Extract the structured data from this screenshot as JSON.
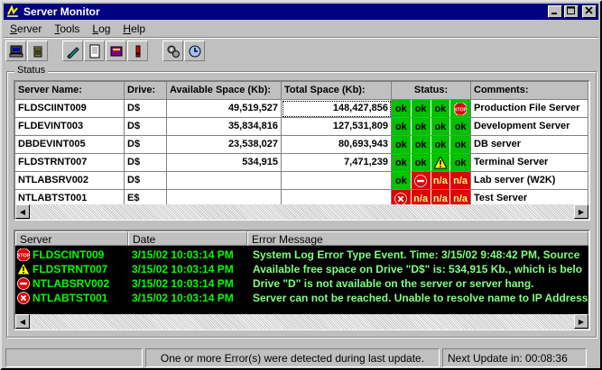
{
  "window": {
    "title": "Server Monitor",
    "controls": {
      "minimize": "_",
      "maximize": "□",
      "close": "×"
    }
  },
  "menu": [
    {
      "label": "Server",
      "u": "S"
    },
    {
      "label": "Tools",
      "u": "T"
    },
    {
      "label": "Log",
      "u": "L"
    },
    {
      "label": "Help",
      "u": "H"
    }
  ],
  "toolbar": [
    "computer-icon",
    "trash-icon",
    "pencil-icon",
    "notepad-icon",
    "book-icon",
    "exclamation-icon",
    "gears-icon",
    "clock-icon"
  ],
  "status_group": {
    "label": "Status"
  },
  "grid": {
    "headers": [
      "Server Name:",
      "Drive:",
      "Available Space (Kb):",
      "Total Space (Kb):",
      "Status:",
      "Comments:"
    ],
    "rows": [
      {
        "server": "FLDSCIINT009",
        "drive": "D$",
        "available": "49,519,527",
        "total": "148,427,856",
        "status": [
          "ok",
          "ok",
          "ok",
          "stop"
        ],
        "comment": "Production File Server"
      },
      {
        "server": "FLDEVINT003",
        "drive": "D$",
        "available": "35,834,816",
        "total": "127,531,809",
        "status": [
          "ok",
          "ok",
          "ok",
          "ok"
        ],
        "comment": "Development Server"
      },
      {
        "server": "DBDEVINT005",
        "drive": "D$",
        "available": "23,538,027",
        "total": "80,693,943",
        "status": [
          "ok",
          "ok",
          "ok",
          "ok"
        ],
        "comment": "DB server"
      },
      {
        "server": "FLDSTRNT007",
        "drive": "D$",
        "available": "534,915",
        "total": "7,471,239",
        "status": [
          "ok",
          "ok",
          "warn",
          "ok"
        ],
        "comment": "Terminal Server"
      },
      {
        "server": "NTLABSRV002",
        "drive": "D$",
        "available": "",
        "total": "",
        "status": [
          "ok",
          "noentry",
          "na",
          "na"
        ],
        "comment": "Lab server (W2K)"
      },
      {
        "server": "NTLABTST001",
        "drive": "E$",
        "available": "",
        "total": "",
        "status": [
          "error",
          "na",
          "na",
          "na"
        ],
        "comment": "Test Server"
      }
    ],
    "status_text": {
      "ok": "ok",
      "na": "n/a"
    }
  },
  "log": {
    "headers": [
      "Server",
      "Date",
      "Error Message"
    ],
    "rows": [
      {
        "icon": "stop",
        "server": "FLDSCINT009",
        "date": "3/15/02 10:03:14 PM",
        "message": "System Log Error Type Event. Time: 3/15/02 9:48:42 PM, Source"
      },
      {
        "icon": "warn",
        "server": "FLDSTRNT007",
        "date": "3/15/02 10:03:14 PM",
        "message": "Available free space on Drive \"D$\" is: 534,915 Kb., which is belo"
      },
      {
        "icon": "noentry",
        "server": "NTLABSRV002",
        "date": "3/15/02 10:03:14 PM",
        "message": "Drive \"D\" is not available on the server or server hang."
      },
      {
        "icon": "error",
        "server": "NTLABTST001",
        "date": "3/15/02 10:03:14 PM",
        "message": "Server can not be reached. Unable to resolve name to IP Address"
      }
    ]
  },
  "statusbar": {
    "message": "One or more Error(s) were detected during last update.",
    "next_update": "Next Update in: 00:08:36"
  },
  "colors": {
    "ok": "#00c000",
    "na": "#e00000",
    "title": "#000080",
    "log_text": "#00ff00"
  }
}
